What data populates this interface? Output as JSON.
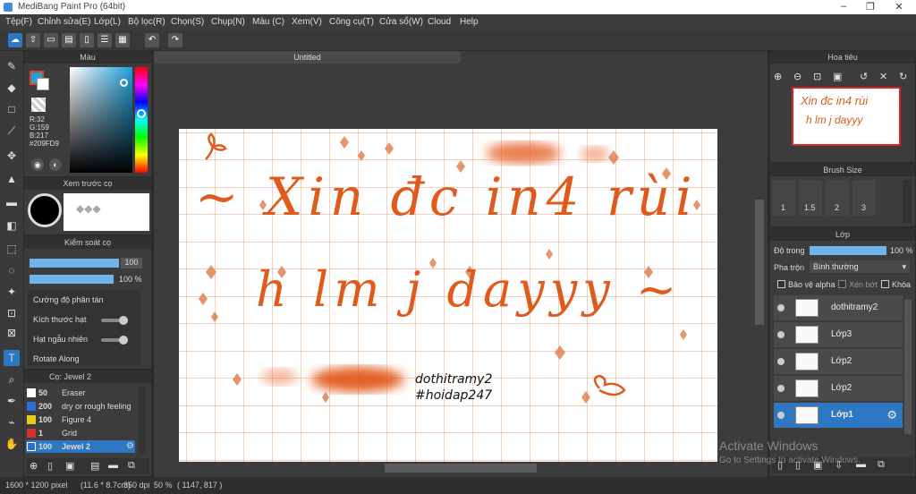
{
  "window": {
    "title": "MediBang Paint Pro (64bit)",
    "min": "–",
    "max": "❐",
    "close": "✕"
  },
  "menu": [
    "Tệp(F)",
    "Chỉnh sửa(E)",
    "Lớp(L)",
    "Bộ lọc(R)",
    "Chọn(S)",
    "Chụp(N)",
    "Màu (C)",
    "Xem(V)",
    "Công cụ(T)",
    "Cửa sổ(W)",
    "Cloud",
    "Help"
  ],
  "color_panel": {
    "title": "Màu",
    "r": "R:32",
    "g": "G:159",
    "b": "B:217",
    "hex": "#209FD9",
    "primary": "#209FD9"
  },
  "preview_panel": {
    "title": "Xem trước cọ"
  },
  "brush_control": {
    "title": "Kiểm soát cọ",
    "size_value": "100",
    "opacity_value": "100 %",
    "items": [
      "Cường độ phân tán",
      "Kích thước hạt",
      "Hạt ngẫu nhiên",
      "Rotate Along"
    ]
  },
  "brush_list": {
    "title": "Cọ: Jewel 2",
    "rows": [
      {
        "num": "50",
        "name": "Eraser",
        "color": "#ffffff"
      },
      {
        "num": "200",
        "name": "dry or rough feeling",
        "color": "#2a6fd6"
      },
      {
        "num": "100",
        "name": "Figure 4",
        "color": "#e6cc1a"
      },
      {
        "num": "1",
        "name": "Grid",
        "color": "#d6302a"
      },
      {
        "num": "100",
        "name": "Jewel 2",
        "color": "#2a6fd6"
      }
    ]
  },
  "document": {
    "tab": "Untitled"
  },
  "canvas_text": {
    "line1": "~ Xin đc in4 rùi",
    "line2": "h lm j dayyy ~",
    "sig1": "dothitramy2",
    "sig2": "#hoidap247"
  },
  "navigator": {
    "title": "Hoa tiêu"
  },
  "brush_size": {
    "title": "Brush Size",
    "sizes": [
      "1",
      "1.5",
      "2",
      "3"
    ]
  },
  "layer_panel": {
    "title": "Lớp",
    "opacity_label": "Độ trong",
    "opacity_value": "100 %",
    "blend_label": "Pha trộn",
    "blend_value": "Bình thường",
    "alpha_label": "Bảo vệ alpha",
    "clip_label": "Xén bớt",
    "lock_label": "Khóa",
    "layers": [
      "dothitramy2",
      "Lớp3",
      "Lớp2",
      "Lớp2",
      "Lớp1"
    ]
  },
  "status": {
    "size": "1600 * 1200 pixel",
    "cm": "(11.6 * 8.7cm)",
    "dpi": "350 dpi",
    "zoom": "50 %",
    "coord": "( 1147, 817 )"
  },
  "watermark": {
    "line1": "Activate Windows",
    "line2": "Go to Settings to activate Windows."
  },
  "colors": {
    "accent": "#2d77c3",
    "ink": "#e05a1c"
  }
}
